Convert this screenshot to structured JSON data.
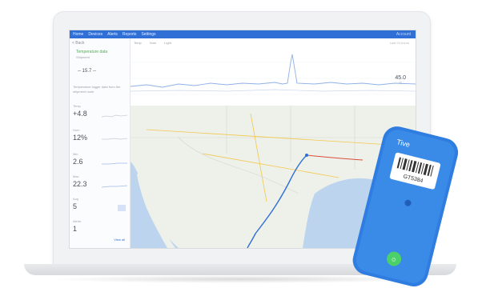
{
  "app": {
    "nav_items": [
      "Home",
      "Devices",
      "Alerts",
      "Reports",
      "Settings"
    ],
    "right_text": "Account"
  },
  "sidebar": {
    "back_label": "< Back",
    "device_title": "Temperature data",
    "device_sub": "Shipment",
    "range": "-- 15.7 --",
    "description": "Temperature logger data from the shipment route",
    "stats": [
      {
        "label": "Temp",
        "value": "+4.8"
      },
      {
        "label": "Hum",
        "value": "12%"
      },
      {
        "label": "Min",
        "value": "2.6"
      },
      {
        "label": "Max",
        "value": "22.3"
      },
      {
        "label": "Avg",
        "value": "5"
      },
      {
        "label": "Alerts",
        "value": "1"
      }
    ],
    "link": "View all"
  },
  "chart": {
    "tabs": [
      "Temp",
      "Hum",
      "Light"
    ],
    "legend": "Last 24 hours",
    "readout_value": "45.0",
    "readout_unit": "°C",
    "series_color": "#8fb1e6",
    "peak_color": "#7ea6e4"
  },
  "map": {
    "land_color": "#eef0ea",
    "water_color": "#bcd4ee",
    "road_color": "#f2c94c",
    "route_color": "#2f6fd6"
  },
  "tracker": {
    "brand": "Tive",
    "code": "GT5384",
    "body_color": "#2f7de0",
    "button_color": "#4cd06a"
  },
  "colors": {
    "accent": "#2f6fd6"
  }
}
